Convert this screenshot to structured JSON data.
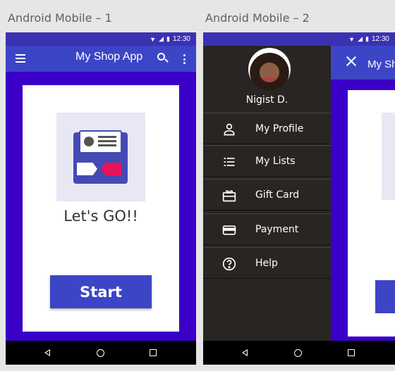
{
  "frames": {
    "frame1_title": "Android Mobile – 1",
    "frame2_title": "Android Mobile – 2"
  },
  "statusbar": {
    "time": "12:30"
  },
  "appbar": {
    "title": "My Shop App"
  },
  "home": {
    "headline": "Let's GO!!",
    "start_label": "Start"
  },
  "drawer": {
    "background_title": "My Sh",
    "user_name": "Nigist D.",
    "items": [
      {
        "label": "My Profile",
        "icon": "person-icon"
      },
      {
        "label": "My Lists",
        "icon": "list-icon"
      },
      {
        "label": "Gift Card",
        "icon": "gift-card-icon"
      },
      {
        "label": "Payment",
        "icon": "credit-card-icon"
      },
      {
        "label": "Help",
        "icon": "help-icon"
      }
    ]
  },
  "colors": {
    "primary": "#3d45c7",
    "background": "#3a00c8",
    "drawer": "#292523",
    "accent": "#e6145a"
  }
}
